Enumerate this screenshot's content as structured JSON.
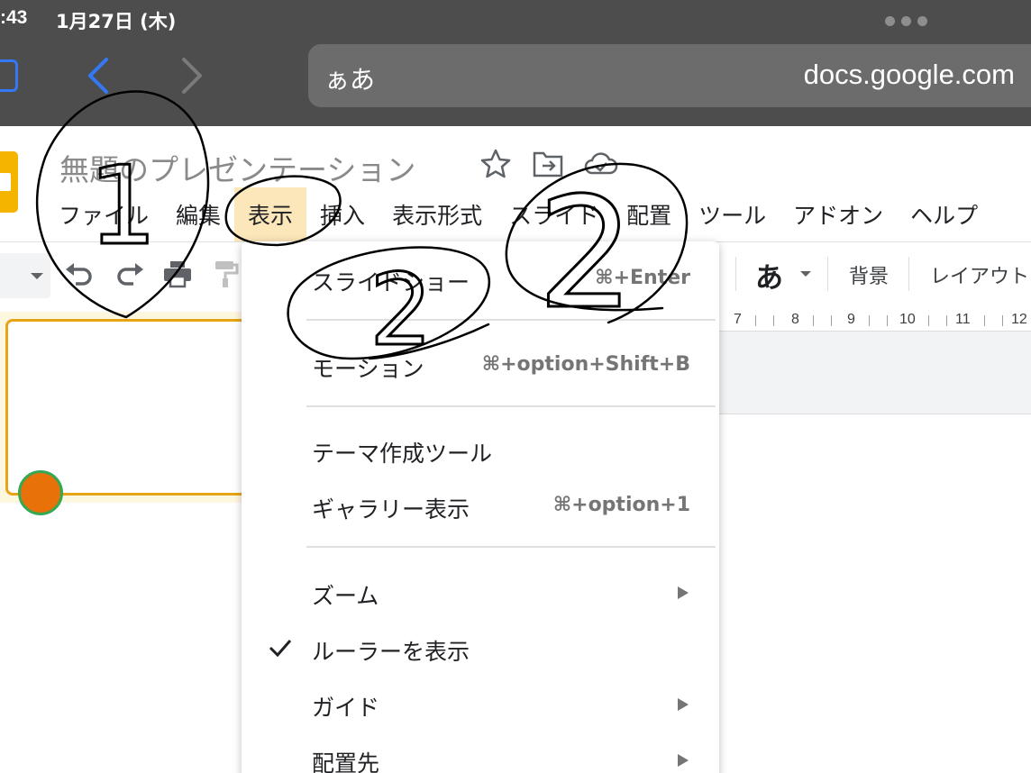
{
  "status_bar": {
    "time": ":43",
    "date": "1月27日 (木)"
  },
  "safari": {
    "reader_label": "ぁあ",
    "url": "docs.google.com"
  },
  "doc": {
    "title": "無題のプレゼンテーション"
  },
  "menu": {
    "items": [
      {
        "label": "ファイル"
      },
      {
        "label": "編集"
      },
      {
        "label": "表示"
      },
      {
        "label": "挿入"
      },
      {
        "label": "表示形式"
      },
      {
        "label": "スライド"
      },
      {
        "label": "配置"
      },
      {
        "label": "ツール"
      },
      {
        "label": "アドオン"
      },
      {
        "label": "ヘルプ"
      }
    ]
  },
  "toolbar": {
    "font_glyph": "あ",
    "background_label": "背景",
    "layout_label": "レイアウト"
  },
  "ruler": {
    "numbers": [
      "7",
      "8",
      "9",
      "10",
      "11",
      "12"
    ]
  },
  "view_menu": {
    "items": [
      {
        "label": "スライドショー",
        "shortcut": "⌘+Enter"
      },
      {
        "label": "モーション",
        "shortcut": "⌘+option+Shift+B"
      },
      {
        "label": "テーマ作成ツール",
        "shortcut": ""
      },
      {
        "label": "ギャラリー表示",
        "shortcut": "⌘+option+1"
      },
      {
        "label": "ズーム",
        "shortcut": ""
      },
      {
        "label": "ルーラーを表示",
        "shortcut": ""
      },
      {
        "label": "ガイド",
        "shortcut": ""
      },
      {
        "label": "配置先",
        "shortcut": ""
      }
    ]
  },
  "annotation_labels": [
    "1",
    "2",
    "2"
  ]
}
